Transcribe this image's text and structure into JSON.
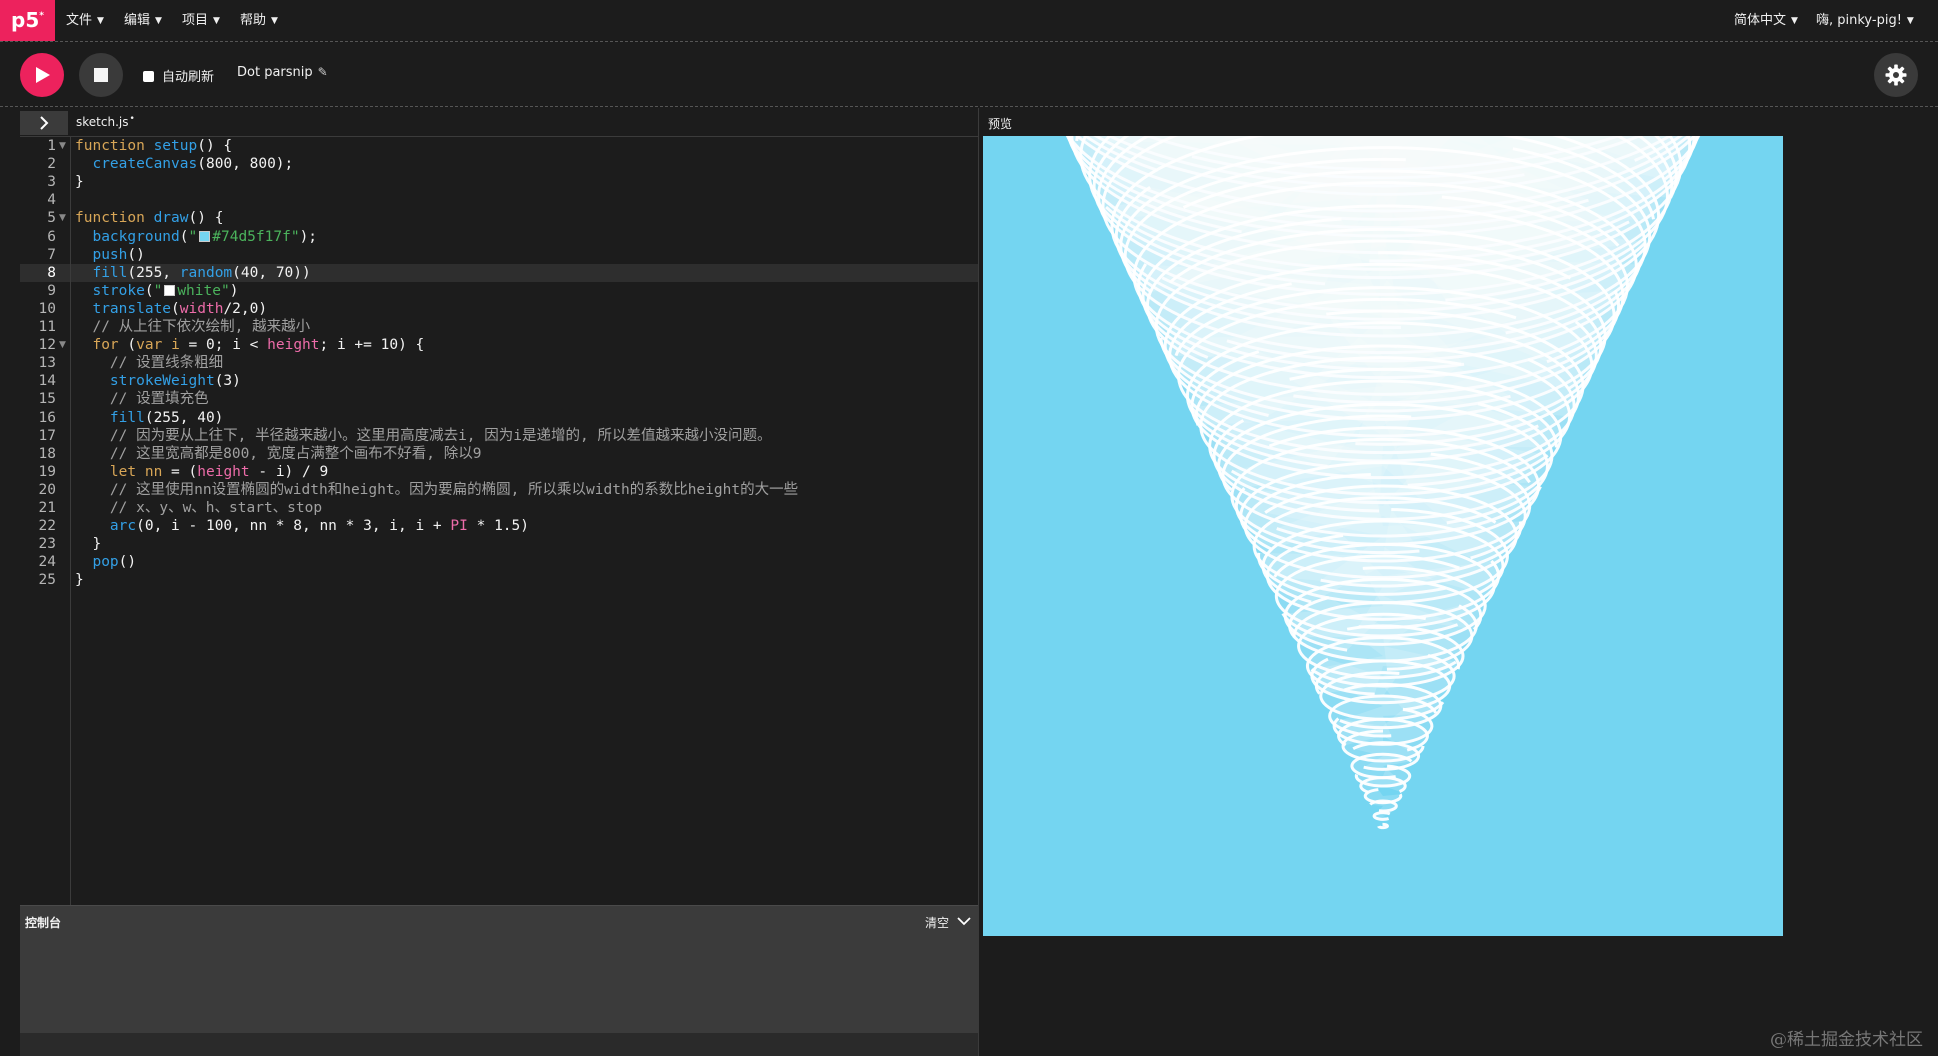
{
  "nav": {
    "logo": "p5",
    "logo_mark": "*",
    "menu": [
      "文件",
      "编辑",
      "项目",
      "帮助"
    ],
    "language": "简体中文",
    "user": "嗨, pinky-pig!"
  },
  "toolbar": {
    "autorefresh_label": "自动刷新",
    "autorefresh_checked": false,
    "sketch_name": "Dot parsnip"
  },
  "editor": {
    "file_name": "sketch.js",
    "unsaved_marker": "•",
    "active_line": 8,
    "line_numbers": [
      "1",
      "2",
      "3",
      "4",
      "5",
      "6",
      "7",
      "8",
      "9",
      "10",
      "11",
      "12",
      "13",
      "14",
      "15",
      "16",
      "17",
      "18",
      "19",
      "20",
      "21",
      "22",
      "23",
      "24",
      "25"
    ],
    "fold_markers": [
      "1",
      "5",
      "12"
    ],
    "lines": [
      "function setup() {",
      "  createCanvas(800, 800);",
      "}",
      "",
      "function draw() {",
      "  background(\"#74d5f17f\");",
      "  push()",
      "  fill(255, random(40, 70))",
      "  stroke(\"white\")",
      "  translate(width/2,0)",
      "  // 从上往下依次绘制, 越来越小",
      "  for (var i = 0; i < height; i += 10) {",
      "    // 设置线条粗细",
      "    strokeWeight(3)",
      "    // 设置填充色",
      "    fill(255, 40)",
      "    // 因为要从上往下, 半径越来越小。这里用高度减去i, 因为i是递增的, 所以差值越来越小没问题。",
      "    // 这里宽高都是800, 宽度占满整个画布不好看, 除以9",
      "    let nn = (height - i) / 9",
      "    // 这里使用nn设置椭圆的width和height。因为要扁的椭圆, 所以乘以width的系数比height的大一些",
      "    // x、y、w、h、start、stop",
      "    arc(0, i - 100, nn * 8, nn * 3, i, i + PI * 1.5)",
      "  }",
      "  pop()",
      "}"
    ]
  },
  "console": {
    "title": "控制台",
    "clear_label": "清空"
  },
  "preview": {
    "label": "预览",
    "background": "#74d5f1",
    "stroke": "#ffffff"
  },
  "watermark": "@稀土掘金技术社区",
  "colors": {
    "accent": "#ed225d",
    "keyword": "#d8a657",
    "function": "#33a0e6",
    "p5_variable": "#ed6ca9",
    "string": "#4bb35c",
    "comment": "#a0a0a0"
  }
}
